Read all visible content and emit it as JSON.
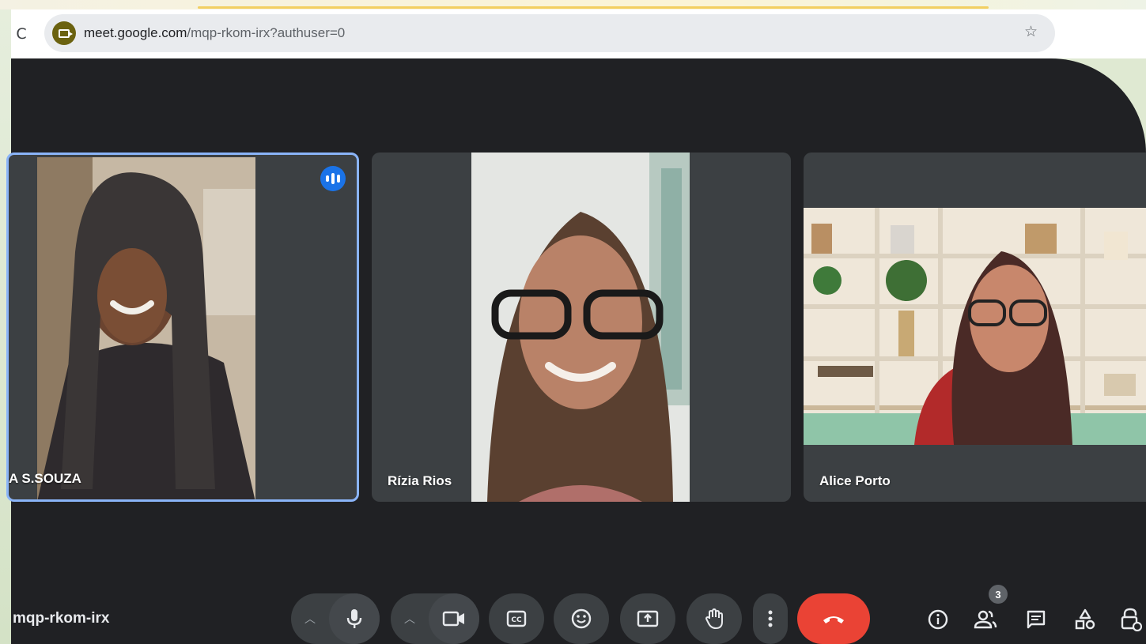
{
  "browser": {
    "reload_glyph": "C",
    "url_host": "meet.google.com",
    "url_path": "/mqp-rkom-irx?authuser=0",
    "star_glyph": "☆"
  },
  "meeting": {
    "code": "mqp-rkom-irx",
    "participants_count": "3"
  },
  "tiles": [
    {
      "name": "A S.SOUZA",
      "speaking": true
    },
    {
      "name": "Rízia Rios",
      "speaking": false
    },
    {
      "name": "Alice Porto",
      "speaking": false
    }
  ],
  "controls": [
    "chevron-up-icon",
    "microphone-icon",
    "chevron-up-icon",
    "camera-icon",
    "captions-icon",
    "emoji-icon",
    "present-icon",
    "raise-hand-icon",
    "more-options-icon",
    "end-call-icon"
  ],
  "right_controls": [
    "info-icon",
    "people-icon",
    "chat-icon",
    "activities-icon",
    "host-controls-icon"
  ],
  "colors": {
    "meet_bg": "#202124",
    "tile_bg": "#3c4043",
    "active_border": "#8ab4f8",
    "end_call": "#ea4335",
    "speaking": "#1a73e8"
  }
}
